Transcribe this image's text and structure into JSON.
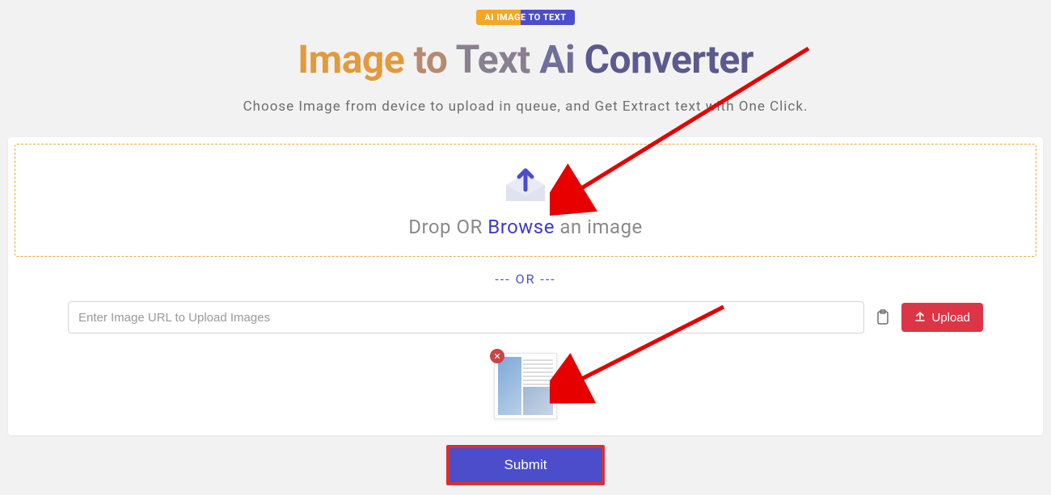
{
  "header": {
    "badge": "AI IMAGE TO TEXT",
    "title": {
      "w1": "Image",
      "w2": "to",
      "w3": "Text",
      "w4": "Ai",
      "w5": "Converter"
    },
    "subtitle": "Choose Image from device to upload in queue, and Get Extract text with One Click."
  },
  "dropzone": {
    "prefix": "Drop OR ",
    "browse": "Browse",
    "suffix": " an image"
  },
  "divider": "--- OR ---",
  "url": {
    "placeholder": "Enter Image URL to Upload Images",
    "upload_label": "Upload"
  },
  "thumb": {
    "close_symbol": "✕"
  },
  "submit": {
    "label": "Submit"
  }
}
